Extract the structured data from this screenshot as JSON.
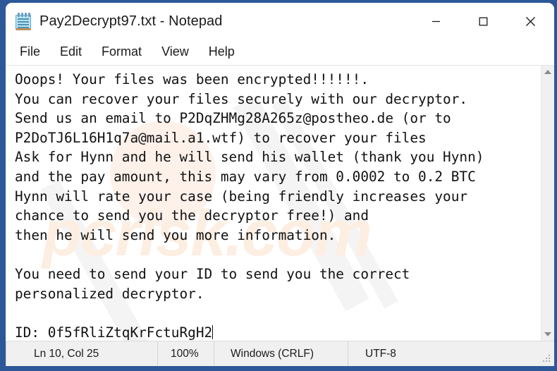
{
  "window": {
    "title": "Pay2Decrypt97.txt - Notepad",
    "icon": "notepad-icon",
    "controls": {
      "minimize": "minimize-icon",
      "maximize": "maximize-icon",
      "close": "close-icon"
    }
  },
  "menu": {
    "items": [
      {
        "label": "File"
      },
      {
        "label": "Edit"
      },
      {
        "label": "Format"
      },
      {
        "label": "View"
      },
      {
        "label": "Help"
      }
    ]
  },
  "document": {
    "body": "Ooops! Your files was been encrypted!!!!!!.\nYou can recover your files securely with our decryptor.\nSend us an email to P2DqZHMg28A265z@postheo.de (or to\nP2DoTJ6L16H1q7a@mail.a1.wtf) to recover your files\nAsk for Hynn and he will send his wallet (thank you Hynn)\nand the pay amount, this may vary from 0.0002 to 0.2 BTC\nHynn will rate your case (being friendly increases your\nchance to send you the decryptor free!) and\nthen he will send you more information.\n\nYou need to send your ID to send you the correct\npersonalized decryptor.\n\nID: 0f5fRliZtqKrFctuRgH2",
    "emails": [
      "P2DqZHMg28A265z@postheo.de",
      "P2DoTJ6L16H1q7a@mail.a1.wtf"
    ],
    "contact_name": "Hynn",
    "ransom_range": "0.0002 to 0.2 BTC",
    "victim_id": "0f5fRliZtqKrFctuRgH2",
    "watermark": "pcrisk.com"
  },
  "scrollbar": {
    "up": "scroll-up-icon",
    "down": "scroll-down-icon"
  },
  "statusbar": {
    "cursor_position": "Ln 10, Col 25",
    "zoom": "100%",
    "line_ending": "Windows (CRLF)",
    "encoding": "UTF-8"
  },
  "colors": {
    "desktop": "#2c5898",
    "window": "#ffffff",
    "statusbar": "#f0f0f0",
    "text": "#111111",
    "watermark": "#fdeee2"
  }
}
